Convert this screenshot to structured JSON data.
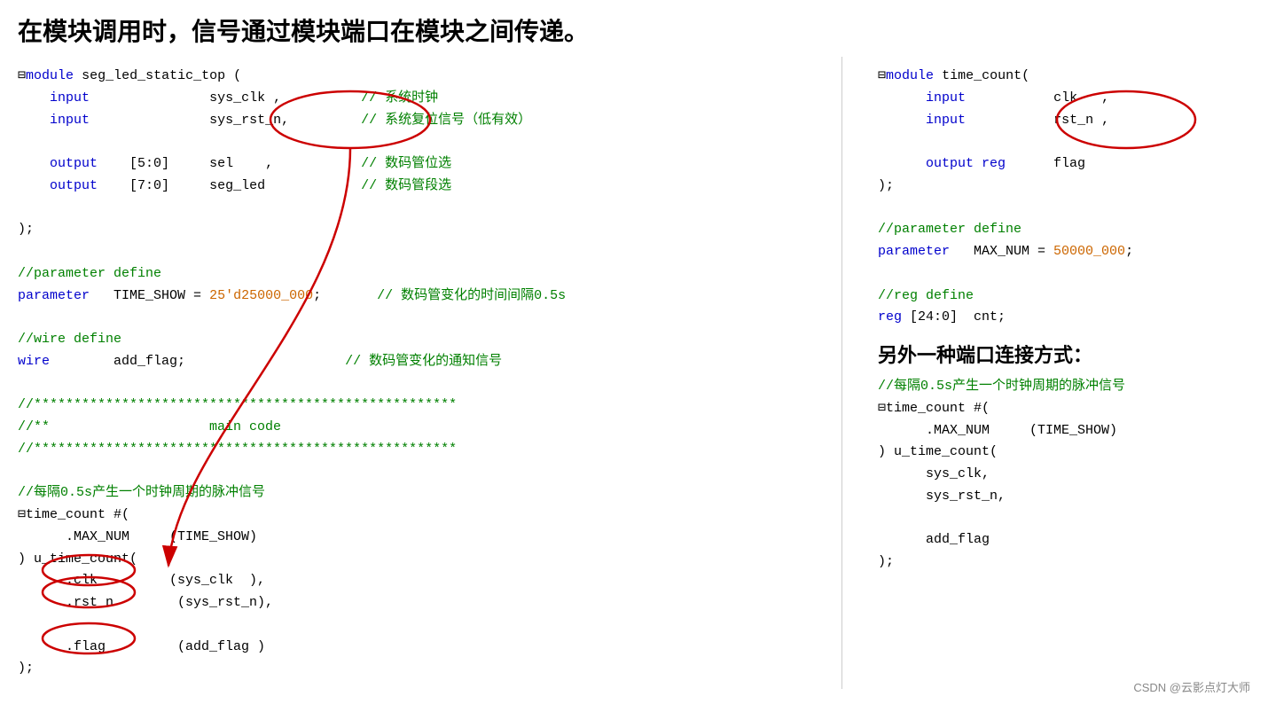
{
  "title": "在模块调用时，信号通过模块端口在模块之间传递。",
  "watermark": "CSDN @云影点灯大师",
  "left": {
    "code_lines": [
      {
        "type": "module_decl",
        "text": "⊟module seg_led_static_top ("
      },
      {
        "type": "indent_blue",
        "text": "    input",
        "extra": "               sys_clk ,",
        "comment": "// 系统时钟"
      },
      {
        "type": "indent_blue",
        "text": "    input",
        "extra": "               sys_rst_n,",
        "comment": "// 系统复位信号（低有效）"
      },
      {
        "type": "blank"
      },
      {
        "type": "indent_blue",
        "text": "    output",
        "extra": "  [5:0]       sel    ,",
        "comment": "// 数码管位选"
      },
      {
        "type": "indent_blue",
        "text": "    output",
        "extra": "  [7:0]       seg_led",
        "comment": "// 数码管段选"
      },
      {
        "type": "blank"
      },
      {
        "type": "plain",
        "text": ");"
      },
      {
        "type": "blank"
      },
      {
        "type": "comment",
        "text": "//parameter define"
      },
      {
        "type": "param",
        "text": "parameter   TIME_SHOW = 25'd25000_000;",
        "comment": "// 数码管变化的时间间隔0.5s"
      },
      {
        "type": "blank"
      },
      {
        "type": "comment",
        "text": "//wire define"
      },
      {
        "type": "wire",
        "text": "wire        add_flag;",
        "comment": "// 数码管变化的通知信号"
      },
      {
        "type": "blank"
      },
      {
        "type": "comment",
        "text": "//*****************************************************"
      },
      {
        "type": "comment",
        "text": "//**                    main code"
      },
      {
        "type": "comment",
        "text": "//*****************************************************"
      },
      {
        "type": "blank"
      },
      {
        "type": "comment",
        "text": "//每隔0.5s产生一个时钟周期的脉冲信号"
      },
      {
        "type": "plain",
        "text": "⊟time_count #("
      },
      {
        "type": "indent1",
        "text": "    .MAX_NUM     (TIME_SHOW)"
      },
      {
        "type": "plain",
        "text": ") u_time_count("
      },
      {
        "type": "indent_dot",
        "text": "    .clk         (sys_clk  ),"
      },
      {
        "type": "indent_dot",
        "text": "    .rst_n        (sys_rst_n),"
      },
      {
        "type": "blank"
      },
      {
        "type": "indent_dot",
        "text": "    .flag         (add_flag )"
      },
      {
        "type": "plain",
        "text": ");"
      }
    ]
  },
  "right": {
    "code_lines": [
      {
        "type": "module_decl",
        "text": "⊟module time_count("
      },
      {
        "type": "indent_blue",
        "text": "    input",
        "extra": "          clk   ,"
      },
      {
        "type": "indent_blue",
        "text": "    input",
        "extra": "          rst_n ,"
      },
      {
        "type": "blank"
      },
      {
        "type": "indent_blue",
        "text": "    output reg  flag"
      },
      {
        "type": "plain",
        "text": ");"
      },
      {
        "type": "blank"
      },
      {
        "type": "comment",
        "text": "//parameter define"
      },
      {
        "type": "param2",
        "text": "parameter   MAX_NUM = 50000_000;"
      },
      {
        "type": "blank"
      },
      {
        "type": "comment",
        "text": "//reg define"
      },
      {
        "type": "reg",
        "text": "reg [24:0]  cnt;"
      }
    ],
    "section_title": "另外一种端口连接方式：",
    "code2_lines": [
      {
        "type": "comment",
        "text": "//每隔0.5s产生一个时钟周期的脉冲信号"
      },
      {
        "type": "plain",
        "text": "⊟time_count #("
      },
      {
        "type": "indent1",
        "text": "    .MAX_NUM     (TIME_SHOW)"
      },
      {
        "type": "plain",
        "text": ") u_time_count("
      },
      {
        "type": "indent1",
        "text": "    sys_clk,"
      },
      {
        "type": "indent1",
        "text": "    sys_rst_n,"
      },
      {
        "type": "blank"
      },
      {
        "type": "indent1",
        "text": "    add_flag"
      },
      {
        "type": "plain",
        "text": ");"
      }
    ]
  }
}
